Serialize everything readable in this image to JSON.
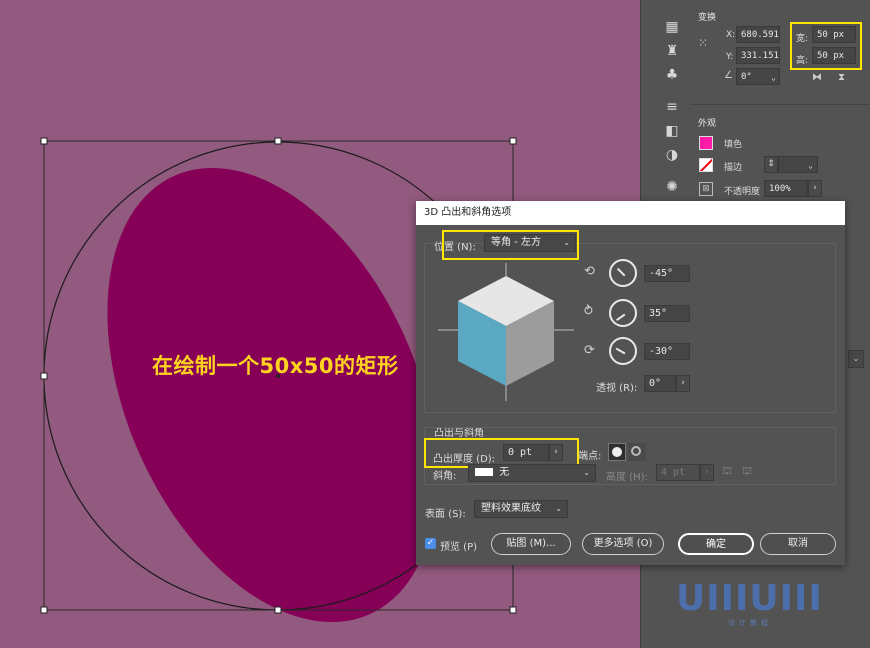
{
  "canvas": {
    "caption": "在绘制一个50x50的矩形"
  },
  "transform_panel": {
    "title": "变换",
    "x_label": "X:",
    "x_value": "680.591",
    "y_label": "Y:",
    "y_value": "331.151",
    "width_label": "宽:",
    "width_value": "50 px",
    "height_label": "高:",
    "height_value": "50 px",
    "rotate_value": "0°"
  },
  "appearance_panel": {
    "title": "外观",
    "fill_label": "填色",
    "stroke_label": "描边",
    "opacity_label": "不透明度",
    "opacity_value": "100%",
    "fill_color": "#ff1aa8"
  },
  "dialog": {
    "title": "3D 凸出和斜角选项",
    "position_label": "位置 (N):",
    "position_value": "等角 - 左方",
    "rotate_x": "-45°",
    "rotate_y": "35°",
    "rotate_z": "-30°",
    "perspective_label": "透视 (R):",
    "perspective_value": "0°",
    "extrude_section": "凸出与斜角",
    "extrude_depth_label": "凸出厚度 (D):",
    "extrude_depth_value": "0 pt",
    "cap_label": "端点:",
    "bevel_label": "斜角:",
    "bevel_value": "无",
    "height_label": "高度 (H):",
    "height_value": "4 pt",
    "surface_label": "表面 (S):",
    "surface_value": "塑料效果底纹",
    "preview_label": "预览 (P)",
    "map_button": "贴图 (M)...",
    "more_options_button": "更多选项 (O)",
    "ok_button": "确定",
    "cancel_button": "取消",
    "cube_face_color": "#5aa8c2"
  },
  "watermark": {
    "text": "UIIIUIII",
    "sub": "设计教程"
  }
}
